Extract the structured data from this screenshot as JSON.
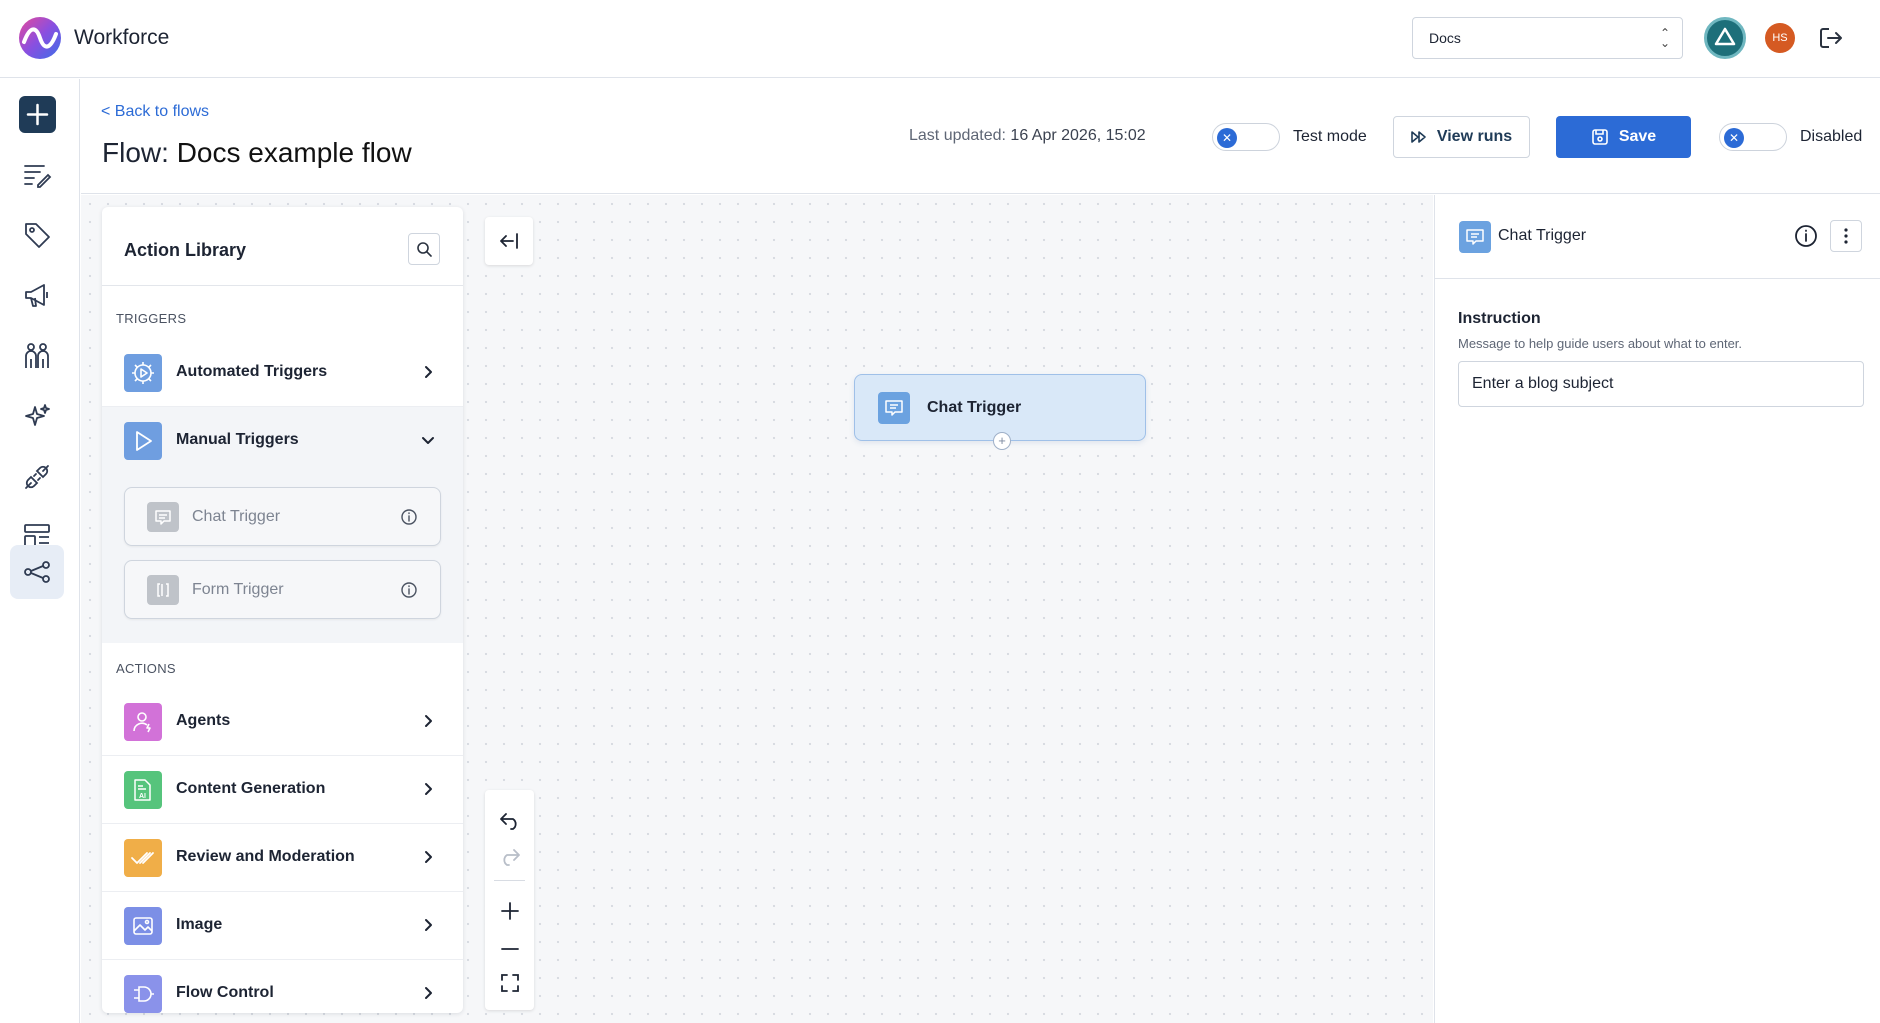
{
  "app": {
    "brand": "Workforce"
  },
  "topbar": {
    "workspace_value": "Docs",
    "avatar_initials": "HS"
  },
  "rail": {
    "items": [
      {
        "icon": "plus-icon"
      },
      {
        "icon": "list-edit-icon"
      },
      {
        "icon": "tag-icon"
      },
      {
        "icon": "megaphone-icon"
      },
      {
        "icon": "people-icon"
      },
      {
        "icon": "sparkle-icon"
      },
      {
        "icon": "plug-icon"
      },
      {
        "icon": "layout-icon"
      },
      {
        "icon": "flow-icon",
        "active": true
      }
    ]
  },
  "header": {
    "back_link": "< Back to flows",
    "title_prefix": "Flow: ",
    "title_name": "Docs example flow",
    "last_updated_label": "Last updated: ",
    "last_updated_value": "16 Apr 2026, 15:02",
    "test_mode_label": "Test mode",
    "view_runs_label": "View runs",
    "save_label": "Save",
    "disabled_label": "Disabled"
  },
  "library": {
    "title": "Action Library",
    "triggers_label": "TRIGGERS",
    "actions_label": "ACTIONS",
    "automated_triggers": "Automated Triggers",
    "manual_triggers": "Manual Triggers",
    "manual_items": [
      "Chat Trigger",
      "Form Trigger"
    ],
    "actions": [
      "Agents",
      "Content Generation",
      "Review and Moderation",
      "Image",
      "Flow Control"
    ]
  },
  "canvas": {
    "node_label": "Chat Trigger"
  },
  "props": {
    "title": "Chat Trigger",
    "field_label": "Instruction",
    "field_help": "Message to help guide users about what to enter.",
    "field_value": "Enter a blog subject"
  },
  "colors": {
    "primary": "#2c6bd6",
    "nav_dark": "#1f3b57",
    "node_bg": "#d9e8f8"
  }
}
